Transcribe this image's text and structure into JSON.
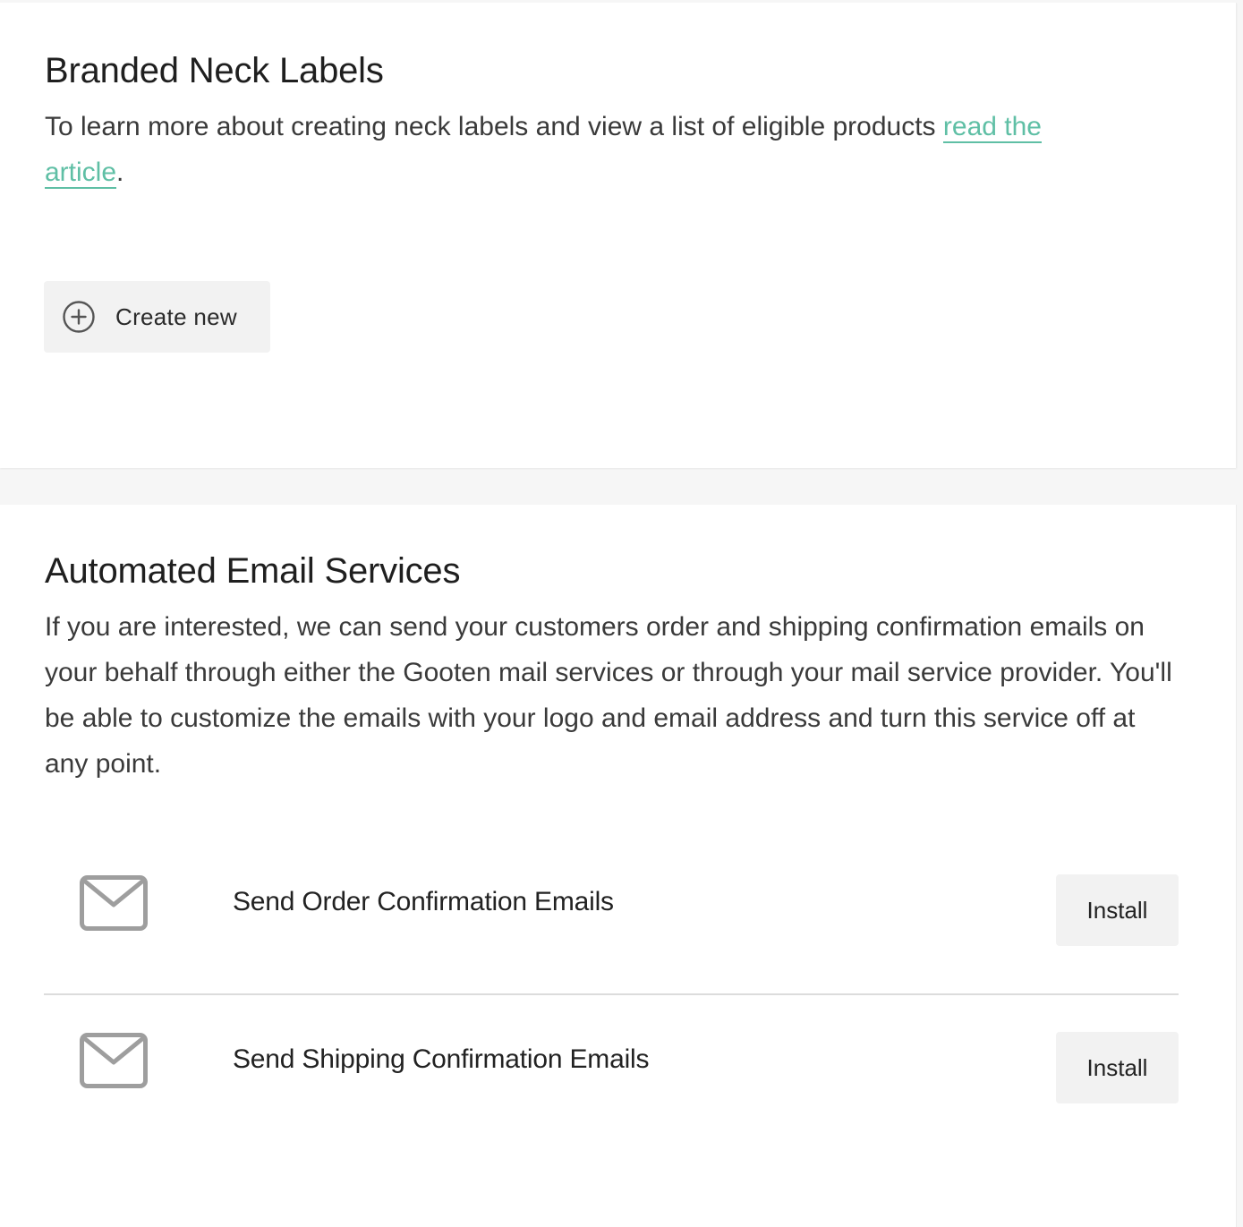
{
  "neck_labels": {
    "title": "Branded Neck Labels",
    "description_prefix": "To learn more about creating neck labels and view a list of eligible products ",
    "link_text_1": "read the",
    "link_text_2": "article",
    "description_suffix": ".",
    "create_button_label": "Create new",
    "create_icon": "plus-circle-icon"
  },
  "email_services": {
    "title": "Automated Email Services",
    "description": "If you are interested, we can send your customers order and shipping confirmation emails on your behalf through either the Gooten mail services or through your mail service provider. You'll be able to customize the emails with your logo and email address and turn this service off at any point.",
    "items": [
      {
        "icon": "envelope-icon",
        "label": "Send Order Confirmation Emails",
        "button_label": "Install"
      },
      {
        "icon": "envelope-icon",
        "label": "Send Shipping Confirmation Emails",
        "button_label": "Install"
      }
    ]
  },
  "colors": {
    "accent": "#5fbfa5",
    "button_bg": "#f2f2f2",
    "icon_gray": "#9e9e9e",
    "page_bg": "#f6f6f6"
  }
}
